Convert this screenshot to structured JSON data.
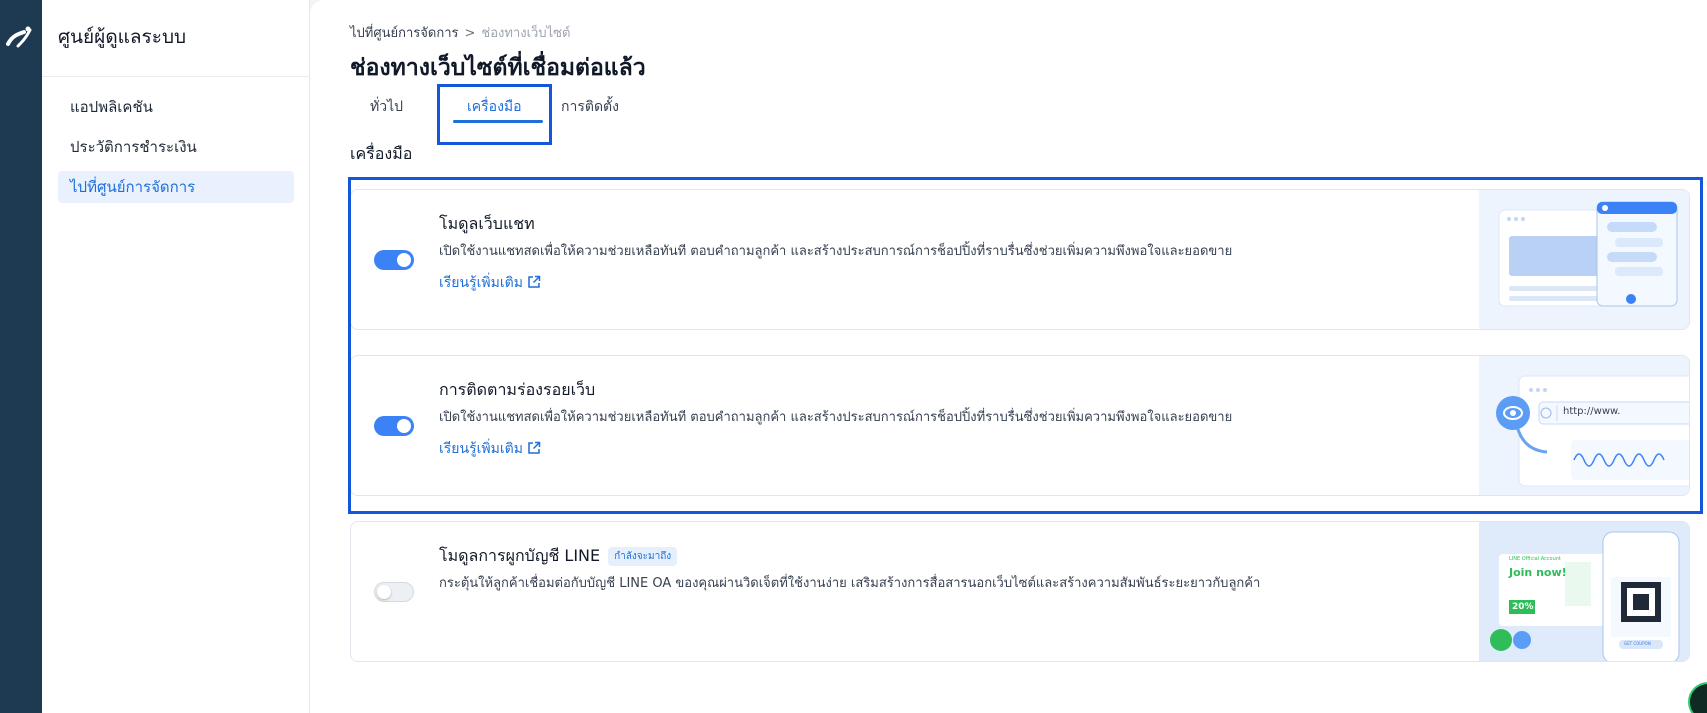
{
  "sidebar": {
    "title": "ศูนย์ผู้ดูแลระบบ",
    "items": [
      {
        "label": "แอปพลิเคชัน",
        "active": false
      },
      {
        "label": "ประวัติการชำระเงิน",
        "active": false
      },
      {
        "label": "ไปที่ศูนย์การจัดการ",
        "active": true
      }
    ]
  },
  "breadcrumb": {
    "parent": "ไปที่ศูนย์การจัดการ",
    "separator": ">",
    "current": "ช่องทางเว็บไซต์"
  },
  "page_title": "ช่องทางเว็บไซต์ที่เชื่อมต่อแล้ว",
  "tabs": [
    {
      "label": "ทั่วไป",
      "active": false
    },
    {
      "label": "เครื่องมือ",
      "active": true
    },
    {
      "label": "การติดตั้ง",
      "active": false
    }
  ],
  "section_title": "เครื่องมือ",
  "cards": [
    {
      "title": "โมดูลเว็บแชท",
      "description": "เปิดใช้งานแชทสดเพื่อให้ความช่วยเหลือทันที ตอบคำถามลูกค้า และสร้างประสบการณ์การช็อปปิ้งที่ราบรื่นซึ่งช่วยเพิ่มความพึงพอใจและยอดขาย",
      "link": "เรียนรู้เพิ่มเติม",
      "enabled": true
    },
    {
      "title": "การติดตามร่องรอยเว็บ",
      "description": "เปิดใช้งานแชทสดเพื่อให้ความช่วยเหลือทันที ตอบคำถามลูกค้า และสร้างประสบการณ์การช็อปปิ้งที่ราบรื่นซึ่งช่วยเพิ่มความพึงพอใจและยอดขาย",
      "link": "เรียนรู้เพิ่มเติม",
      "enabled": true,
      "illustration_text": "http://www."
    },
    {
      "title": "โมดูลการผูกบัญชี LINE",
      "badge": "กำลังจะมาถึง",
      "description": "กระตุ้นให้ลูกค้าเชื่อมต่อกับบัญชี LINE OA ของคุณผ่านวิดเจ็ตที่ใช้งานง่าย เสริมสร้างการสื่อสารนอกเว็บไซต์และสร้างความสัมพันธ์ระยะยาวกับลูกค้า",
      "enabled": false,
      "illustration": {
        "header": "LINE Official Account",
        "join": "Join now!",
        "discount": "20%",
        "coupon": "GET COUPON"
      }
    }
  ],
  "colors": {
    "accent": "#1e6fd9",
    "rail": "#1e3a52",
    "toggle_on": "#3b82f6",
    "highlight": "#1456d9"
  }
}
